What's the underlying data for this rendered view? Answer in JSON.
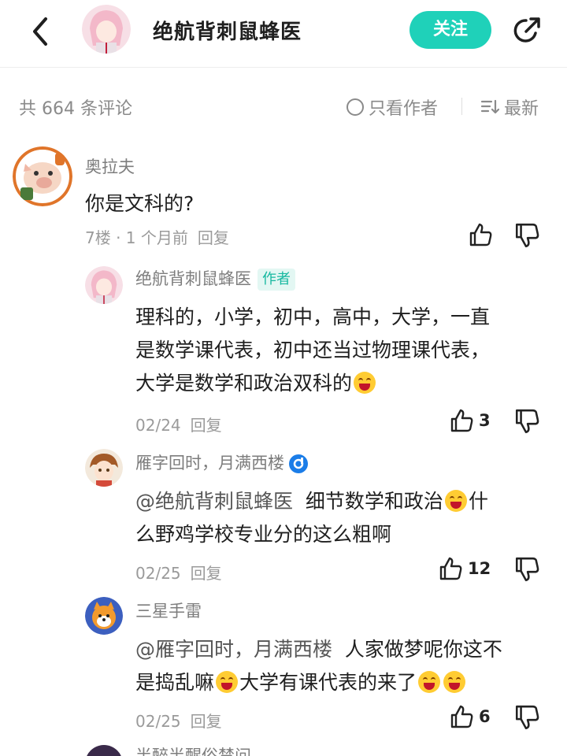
{
  "header": {
    "title": "绝航背刺鼠蜂医",
    "follow_label": "关注"
  },
  "subbar": {
    "count_label": "共 664 条评论",
    "author_only_label": "只看作者",
    "sort_label": "最新"
  },
  "comments": [
    {
      "name": "奥拉夫",
      "text": "你是文科的?",
      "meta": "7楼 · 1 个月前",
      "reply_label": "回复",
      "likes": ""
    },
    {
      "name": "绝航背刺鼠蜂医",
      "badge": "作者",
      "line1": "理科的，小学，初中，高中，大学，一直",
      "line2": "是数学课代表，初中还当过物理课代表，",
      "line3": "大学是数学和政治双科的",
      "meta": "02/24",
      "reply_label": "回复",
      "likes": "3"
    },
    {
      "name": "雁字回时，月满西楼",
      "mention": "@绝航背刺鼠蜂医",
      "line1": "细节数学和政治",
      "line1b": "什",
      "line2": "么野鸡学校专业分的这么粗啊",
      "meta": "02/25",
      "reply_label": "回复",
      "likes": "12"
    },
    {
      "name": "三星手雷",
      "mention": "@雁字回时，月满西楼",
      "line1": "人家做梦呢你这不",
      "line2a": "是捣乱嘛",
      "line2b": "大学有课代表的来了",
      "meta": "02/25",
      "reply_label": "回复",
      "likes": "6"
    },
    {
      "name": "半醉半醒俗禁问"
    }
  ],
  "colors": {
    "accent": "#1fd1b9",
    "muted": "#8a8a8a"
  }
}
